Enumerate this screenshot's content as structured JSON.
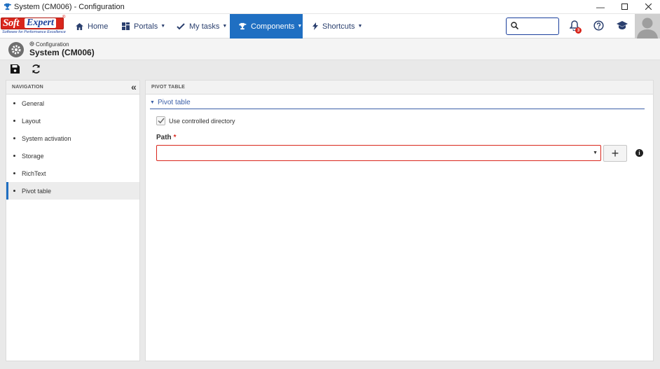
{
  "window": {
    "title": "System (CM006) - Configuration",
    "minimize_icon": "minimize-icon",
    "maximize_icon": "maximize-icon",
    "close_icon": "close-icon"
  },
  "brand": {
    "logo_soft": "Soft",
    "logo_expert": "Expert",
    "logo_tagline": "Software for Performance Excellence",
    "brand_red": "#d9261c",
    "brand_blue": "#1a3f9c"
  },
  "topnav": {
    "items": [
      {
        "label": "Home",
        "icon": "home-icon"
      },
      {
        "label": "Portals",
        "icon": "portals-icon"
      },
      {
        "label": "My tasks",
        "icon": "check-icon"
      },
      {
        "label": "Components",
        "icon": "trophy-icon",
        "active": true
      },
      {
        "label": "Shortcuts",
        "icon": "bolt-icon"
      }
    ],
    "search_placeholder": "",
    "notification_count": "3",
    "accent": "#1f6fc2"
  },
  "page": {
    "breadcrumb": "Configuration",
    "title": "System (CM006)"
  },
  "toolbar": {
    "save_icon": "save-icon",
    "refresh_icon": "refresh-icon"
  },
  "navigation": {
    "header": "NAVIGATION",
    "items": [
      {
        "label": "General"
      },
      {
        "label": "Layout"
      },
      {
        "label": "System activation"
      },
      {
        "label": "Storage"
      },
      {
        "label": "RichText"
      },
      {
        "label": "Pivot table",
        "selected": true
      }
    ]
  },
  "main": {
    "header": "PIVOT TABLE",
    "section_title": "Pivot table",
    "checkbox_label": "Use controlled directory",
    "checkbox_checked": true,
    "path_label": "Path",
    "path_required_mark": "*",
    "path_value": "",
    "add_button_label": "+"
  }
}
